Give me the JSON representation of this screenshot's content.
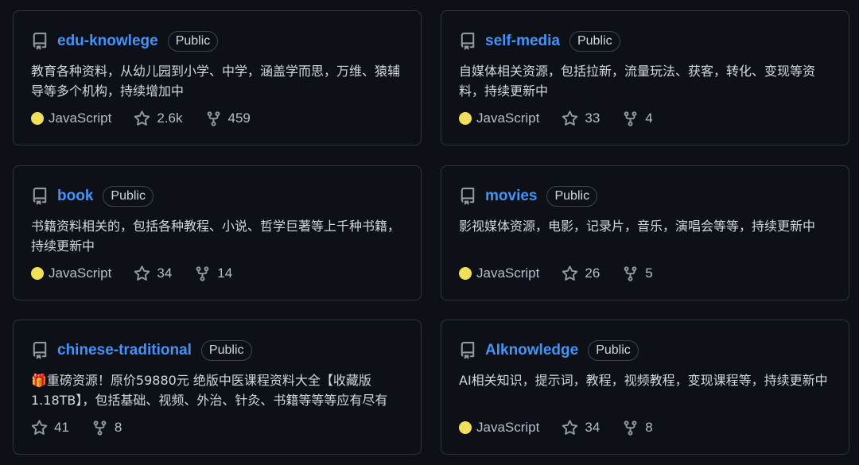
{
  "colors": {
    "link": "#4493f8",
    "javascript": "#f1e05a",
    "border": "#30363d",
    "background": "#0d1117"
  },
  "repos": [
    {
      "name": "edu-knowlege",
      "visibility": "Public",
      "description": "教育各种资料，从幼儿园到小学、中学，涵盖学而思，万维、猿辅导等多个机构，持续增加中",
      "language": "JavaScript",
      "stars": "2.6k",
      "forks": "459"
    },
    {
      "name": "self-media",
      "visibility": "Public",
      "description": "自媒体相关资源，包括拉新，流量玩法、获客，转化、变现等资料，持续更新中",
      "language": "JavaScript",
      "stars": "33",
      "forks": "4"
    },
    {
      "name": "book",
      "visibility": "Public",
      "description": "书籍资料相关的，包括各种教程、小说、哲学巨著等上千种书籍，持续更新中",
      "language": "JavaScript",
      "stars": "34",
      "forks": "14"
    },
    {
      "name": "movies",
      "visibility": "Public",
      "description": "影视媒体资源，电影，记录片，音乐，演唱会等等，持续更新中",
      "language": "JavaScript",
      "stars": "26",
      "forks": "5"
    },
    {
      "name": "chinese-traditional",
      "visibility": "Public",
      "description": "🎁重磅资源！原价59880元 绝版中医课程资料大全【收藏版1.18TB】，包括基础、视频、外治、针灸、书籍等等等应有尽有",
      "language": "",
      "stars": "41",
      "forks": "8"
    },
    {
      "name": "AIknowledge",
      "visibility": "Public",
      "description": "AI相关知识，提示词，教程，视频教程，变现课程等，持续更新中",
      "language": "JavaScript",
      "stars": "34",
      "forks": "8"
    }
  ]
}
